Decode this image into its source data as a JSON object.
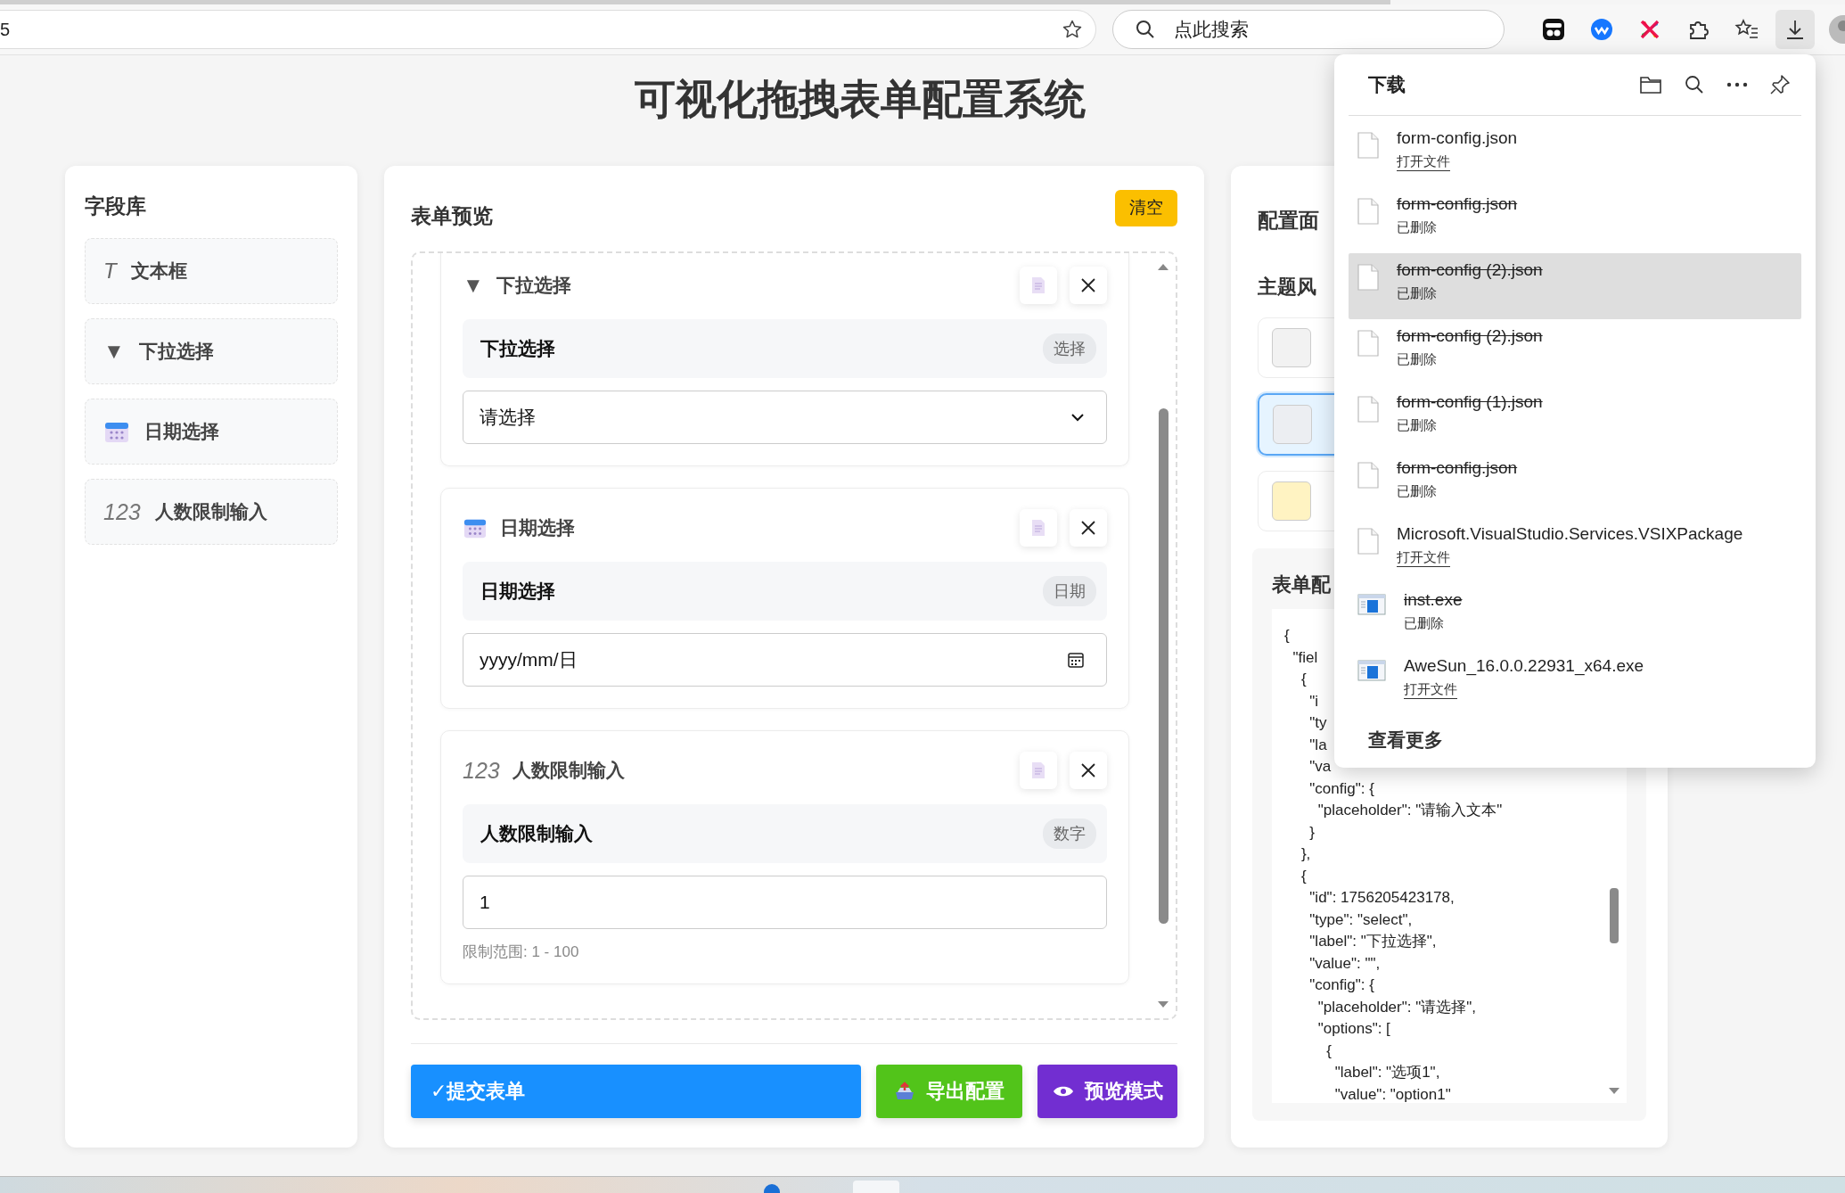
{
  "browser": {
    "address": "5",
    "search_placeholder": "点此搜索"
  },
  "title": "可视化拖拽表单配置系统",
  "field_library": {
    "title": "字段库",
    "items": [
      {
        "kind": "text",
        "icon": "T",
        "label": "文本框"
      },
      {
        "kind": "select",
        "icon": "▼",
        "label": "下拉选择"
      },
      {
        "kind": "date",
        "label": "日期选择"
      },
      {
        "kind": "number",
        "icon": "123",
        "label": "人数限制输入"
      }
    ]
  },
  "form_preview": {
    "title": "表单预览",
    "clear_button": "清空",
    "fields": [
      {
        "kind": "select",
        "icon": "▼",
        "header": "下拉选择",
        "label": "下拉选择",
        "type_badge": "选择",
        "placeholder": "请选择"
      },
      {
        "kind": "date",
        "header": "日期选择",
        "label": "日期选择",
        "type_badge": "日期",
        "value": "yyyy/mm/日"
      },
      {
        "kind": "number",
        "icon": "123",
        "header": "人数限制输入",
        "label": "人数限制输入",
        "type_badge": "数字",
        "value": "1",
        "hint": "限制范围: 1 - 100"
      }
    ],
    "buttons": [
      {
        "kind": "submit",
        "label": "✓提交表单"
      },
      {
        "kind": "export",
        "label": "导出配置"
      },
      {
        "kind": "preview",
        "label": "预览模式"
      }
    ]
  },
  "config_panel": {
    "title": "配置面",
    "theme_title": "主题风",
    "themes": [
      {
        "color": "#f2f2f2",
        "selected": false
      },
      {
        "color": "#eceef2",
        "selected": true
      },
      {
        "color": "#fff3c2",
        "selected": false
      }
    ],
    "json_title": "表单配",
    "code_lines": [
      "{",
      "  \"fiel",
      "    {",
      "      \"i",
      "      \"ty",
      "      \"la",
      "      \"va",
      "      \"config\": {",
      "        \"placeholder\": \"请输入文本\"",
      "      }",
      "    },",
      "    {",
      "      \"id\": 1756205423178,",
      "      \"type\": \"select\",",
      "      \"label\": \"下拉选择\",",
      "      \"value\": \"\",",
      "      \"config\": {",
      "        \"placeholder\": \"请选择\",",
      "        \"options\": [",
      "          {",
      "            \"label\": \"选项1\",",
      "            \"value\": \"option1\""
    ]
  },
  "downloads": {
    "title": "下载",
    "items": [
      {
        "kind": "file",
        "name": "form-config.json",
        "status": "打开文件",
        "deleted": false,
        "highlighted": false
      },
      {
        "kind": "file",
        "name": "form-config.json",
        "status": "已删除",
        "deleted": true,
        "highlighted": false
      },
      {
        "kind": "file",
        "name": "form-config (2).json",
        "status": "已删除",
        "deleted": true,
        "highlighted": true
      },
      {
        "kind": "file",
        "name": "form-config (2).json",
        "status": "已删除",
        "deleted": true,
        "highlighted": false
      },
      {
        "kind": "file",
        "name": "form-config (1).json",
        "status": "已删除",
        "deleted": true,
        "highlighted": false
      },
      {
        "kind": "file",
        "name": "form-config.json",
        "status": "已删除",
        "deleted": true,
        "highlighted": false
      },
      {
        "kind": "file",
        "name": "Microsoft.VisualStudio.Services.VSIXPackage",
        "status": "打开文件",
        "deleted": false,
        "highlighted": false
      },
      {
        "kind": "exe",
        "name": "inst.exe",
        "status": "已删除",
        "deleted": true,
        "highlighted": false
      },
      {
        "kind": "exe",
        "name": "AweSun_16.0.0.22931_x64.exe",
        "status": "打开文件",
        "deleted": false,
        "highlighted": false
      }
    ],
    "more": "查看更多"
  }
}
